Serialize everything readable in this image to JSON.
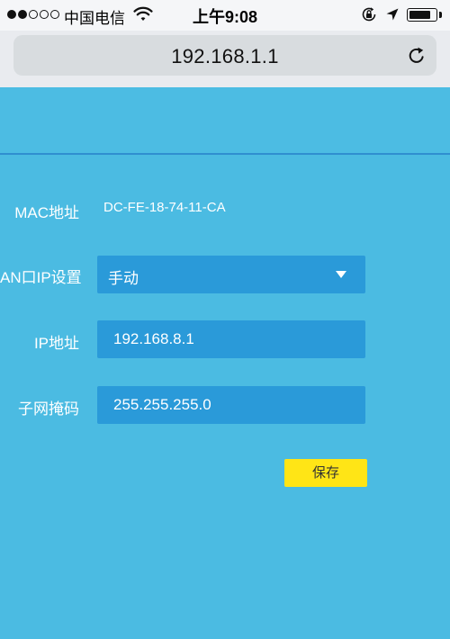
{
  "status_bar": {
    "carrier": "中国电信",
    "time": "上午9:08",
    "signal_bars_filled": 2,
    "signal_bars_total": 5,
    "battery_level": 0.85,
    "icons": [
      "wifi-icon",
      "rotation-lock-icon",
      "location-icon",
      "battery-icon"
    ]
  },
  "browser": {
    "url": "192.168.1.1",
    "icons": [
      "reload-icon"
    ]
  },
  "form": {
    "mac": {
      "label": "MAC地址",
      "value": "DC-FE-18-74-11-CA"
    },
    "wan_ip_setting": {
      "label": "AN口IP设置",
      "value": "手动"
    },
    "ip_address": {
      "label": "IP地址",
      "value": "192.168.8.1"
    },
    "subnet_mask": {
      "label": "子网掩码",
      "value": "255.255.255.0"
    },
    "save_label": "保存"
  },
  "colors": {
    "page_background": "#4bbbe2",
    "field_background": "#2a9ad9",
    "save_button": "#ffe516",
    "header_rule": "#2f8fd0"
  }
}
